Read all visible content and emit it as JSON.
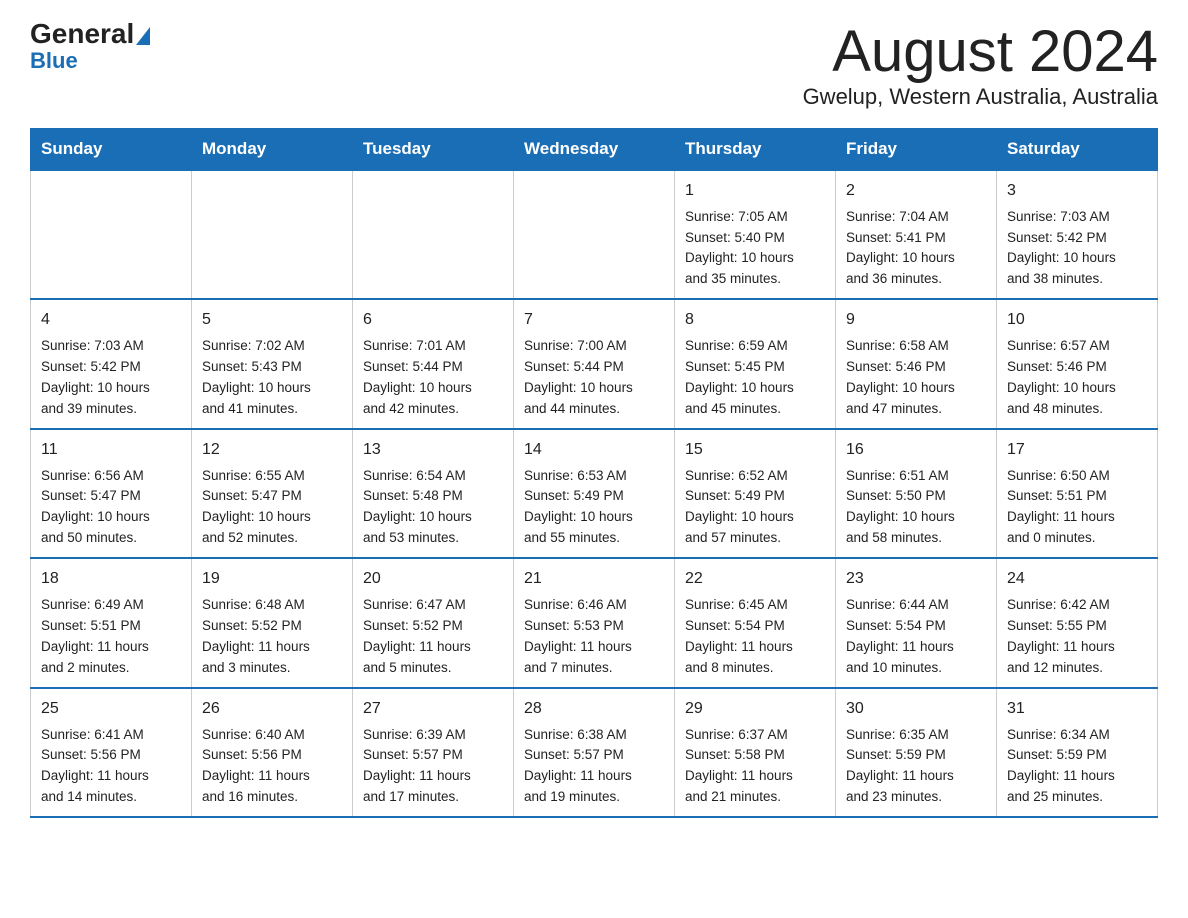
{
  "logo": {
    "general": "General",
    "blue": "Blue"
  },
  "title": "August 2024",
  "subtitle": "Gwelup, Western Australia, Australia",
  "days": [
    "Sunday",
    "Monday",
    "Tuesday",
    "Wednesday",
    "Thursday",
    "Friday",
    "Saturday"
  ],
  "weeks": [
    [
      {
        "num": "",
        "info": ""
      },
      {
        "num": "",
        "info": ""
      },
      {
        "num": "",
        "info": ""
      },
      {
        "num": "",
        "info": ""
      },
      {
        "num": "1",
        "info": "Sunrise: 7:05 AM\nSunset: 5:40 PM\nDaylight: 10 hours\nand 35 minutes."
      },
      {
        "num": "2",
        "info": "Sunrise: 7:04 AM\nSunset: 5:41 PM\nDaylight: 10 hours\nand 36 minutes."
      },
      {
        "num": "3",
        "info": "Sunrise: 7:03 AM\nSunset: 5:42 PM\nDaylight: 10 hours\nand 38 minutes."
      }
    ],
    [
      {
        "num": "4",
        "info": "Sunrise: 7:03 AM\nSunset: 5:42 PM\nDaylight: 10 hours\nand 39 minutes."
      },
      {
        "num": "5",
        "info": "Sunrise: 7:02 AM\nSunset: 5:43 PM\nDaylight: 10 hours\nand 41 minutes."
      },
      {
        "num": "6",
        "info": "Sunrise: 7:01 AM\nSunset: 5:44 PM\nDaylight: 10 hours\nand 42 minutes."
      },
      {
        "num": "7",
        "info": "Sunrise: 7:00 AM\nSunset: 5:44 PM\nDaylight: 10 hours\nand 44 minutes."
      },
      {
        "num": "8",
        "info": "Sunrise: 6:59 AM\nSunset: 5:45 PM\nDaylight: 10 hours\nand 45 minutes."
      },
      {
        "num": "9",
        "info": "Sunrise: 6:58 AM\nSunset: 5:46 PM\nDaylight: 10 hours\nand 47 minutes."
      },
      {
        "num": "10",
        "info": "Sunrise: 6:57 AM\nSunset: 5:46 PM\nDaylight: 10 hours\nand 48 minutes."
      }
    ],
    [
      {
        "num": "11",
        "info": "Sunrise: 6:56 AM\nSunset: 5:47 PM\nDaylight: 10 hours\nand 50 minutes."
      },
      {
        "num": "12",
        "info": "Sunrise: 6:55 AM\nSunset: 5:47 PM\nDaylight: 10 hours\nand 52 minutes."
      },
      {
        "num": "13",
        "info": "Sunrise: 6:54 AM\nSunset: 5:48 PM\nDaylight: 10 hours\nand 53 minutes."
      },
      {
        "num": "14",
        "info": "Sunrise: 6:53 AM\nSunset: 5:49 PM\nDaylight: 10 hours\nand 55 minutes."
      },
      {
        "num": "15",
        "info": "Sunrise: 6:52 AM\nSunset: 5:49 PM\nDaylight: 10 hours\nand 57 minutes."
      },
      {
        "num": "16",
        "info": "Sunrise: 6:51 AM\nSunset: 5:50 PM\nDaylight: 10 hours\nand 58 minutes."
      },
      {
        "num": "17",
        "info": "Sunrise: 6:50 AM\nSunset: 5:51 PM\nDaylight: 11 hours\nand 0 minutes."
      }
    ],
    [
      {
        "num": "18",
        "info": "Sunrise: 6:49 AM\nSunset: 5:51 PM\nDaylight: 11 hours\nand 2 minutes."
      },
      {
        "num": "19",
        "info": "Sunrise: 6:48 AM\nSunset: 5:52 PM\nDaylight: 11 hours\nand 3 minutes."
      },
      {
        "num": "20",
        "info": "Sunrise: 6:47 AM\nSunset: 5:52 PM\nDaylight: 11 hours\nand 5 minutes."
      },
      {
        "num": "21",
        "info": "Sunrise: 6:46 AM\nSunset: 5:53 PM\nDaylight: 11 hours\nand 7 minutes."
      },
      {
        "num": "22",
        "info": "Sunrise: 6:45 AM\nSunset: 5:54 PM\nDaylight: 11 hours\nand 8 minutes."
      },
      {
        "num": "23",
        "info": "Sunrise: 6:44 AM\nSunset: 5:54 PM\nDaylight: 11 hours\nand 10 minutes."
      },
      {
        "num": "24",
        "info": "Sunrise: 6:42 AM\nSunset: 5:55 PM\nDaylight: 11 hours\nand 12 minutes."
      }
    ],
    [
      {
        "num": "25",
        "info": "Sunrise: 6:41 AM\nSunset: 5:56 PM\nDaylight: 11 hours\nand 14 minutes."
      },
      {
        "num": "26",
        "info": "Sunrise: 6:40 AM\nSunset: 5:56 PM\nDaylight: 11 hours\nand 16 minutes."
      },
      {
        "num": "27",
        "info": "Sunrise: 6:39 AM\nSunset: 5:57 PM\nDaylight: 11 hours\nand 17 minutes."
      },
      {
        "num": "28",
        "info": "Sunrise: 6:38 AM\nSunset: 5:57 PM\nDaylight: 11 hours\nand 19 minutes."
      },
      {
        "num": "29",
        "info": "Sunrise: 6:37 AM\nSunset: 5:58 PM\nDaylight: 11 hours\nand 21 minutes."
      },
      {
        "num": "30",
        "info": "Sunrise: 6:35 AM\nSunset: 5:59 PM\nDaylight: 11 hours\nand 23 minutes."
      },
      {
        "num": "31",
        "info": "Sunrise: 6:34 AM\nSunset: 5:59 PM\nDaylight: 11 hours\nand 25 minutes."
      }
    ]
  ]
}
